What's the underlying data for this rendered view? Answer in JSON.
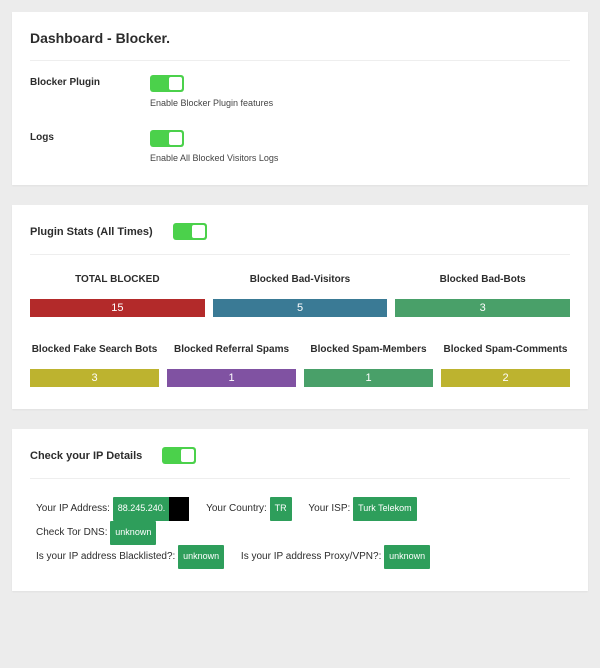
{
  "dashboard": {
    "title": "Dashboard - Blocker.",
    "settings": {
      "plugin_label": "Blocker Plugin",
      "plugin_hint": "Enable Blocker Plugin features",
      "logs_label": "Logs",
      "logs_hint": "Enable All Blocked Visitors Logs"
    }
  },
  "stats": {
    "title": "Plugin Stats (All Times)",
    "row1": [
      {
        "label": "TOTAL BLOCKED",
        "value": "15",
        "color": "c-red"
      },
      {
        "label": "Blocked Bad-Visitors",
        "value": "5",
        "color": "c-blue"
      },
      {
        "label": "Blocked Bad-Bots",
        "value": "3",
        "color": "c-green"
      }
    ],
    "row2": [
      {
        "label": "Blocked Fake Search Bots",
        "value": "3",
        "color": "c-olive"
      },
      {
        "label": "Blocked Referral Spams",
        "value": "1",
        "color": "c-purple"
      },
      {
        "label": "Blocked Spam-Members",
        "value": "1",
        "color": "c-green"
      },
      {
        "label": "Blocked Spam-Comments",
        "value": "2",
        "color": "c-olive"
      }
    ]
  },
  "ip": {
    "title": "Check your IP Details",
    "items": {
      "address_label": "Your IP Address:",
      "address_value": "88.245.240.",
      "country_label": "Your Country:",
      "country_value": "TR",
      "isp_label": "Your ISP:",
      "isp_value": "Turk Telekom",
      "tor_label": "Check Tor DNS:",
      "tor_value": "unknown",
      "blacklist_label": "Is your IP address Blacklisted?:",
      "blacklist_value": "unknown",
      "proxy_label": "Is your IP address Proxy/VPN?:",
      "proxy_value": "unknown"
    }
  }
}
